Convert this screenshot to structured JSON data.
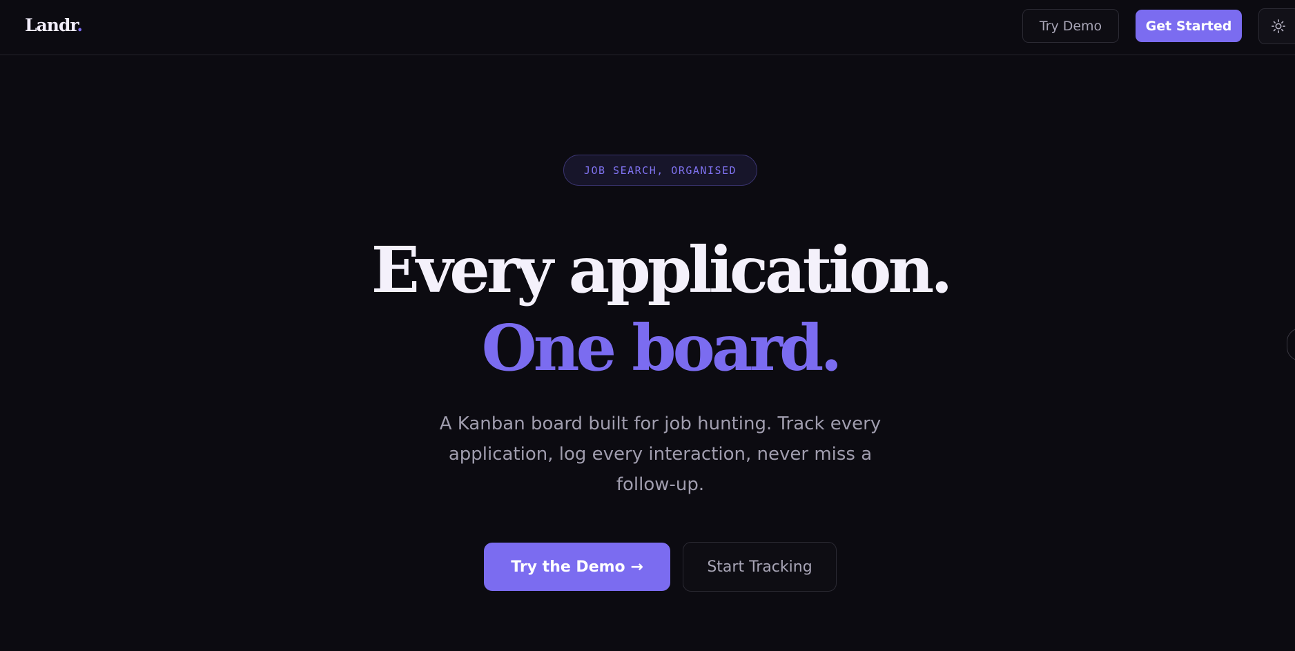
{
  "nav": {
    "logo_text": "Landr",
    "logo_dot": ".",
    "try_demo_label": "Try Demo",
    "get_started_label": "Get Started",
    "theme_toggle_icon": "sun-icon"
  },
  "hero": {
    "eyebrow": "JOB SEARCH, ORGANISED",
    "headline_line1": "Every application.",
    "headline_line2": "One board.",
    "subtitle": "A Kanban board built for job hunting. Track every application, log every interaction, never miss a follow-up.",
    "primary_cta_label": "Try the Demo →",
    "secondary_cta_label": "Start Tracking"
  },
  "colors": {
    "background": "#0c0b11",
    "accent": "#7b6cf0",
    "text_primary": "#f4f1fb",
    "text_muted": "#a09dae"
  }
}
